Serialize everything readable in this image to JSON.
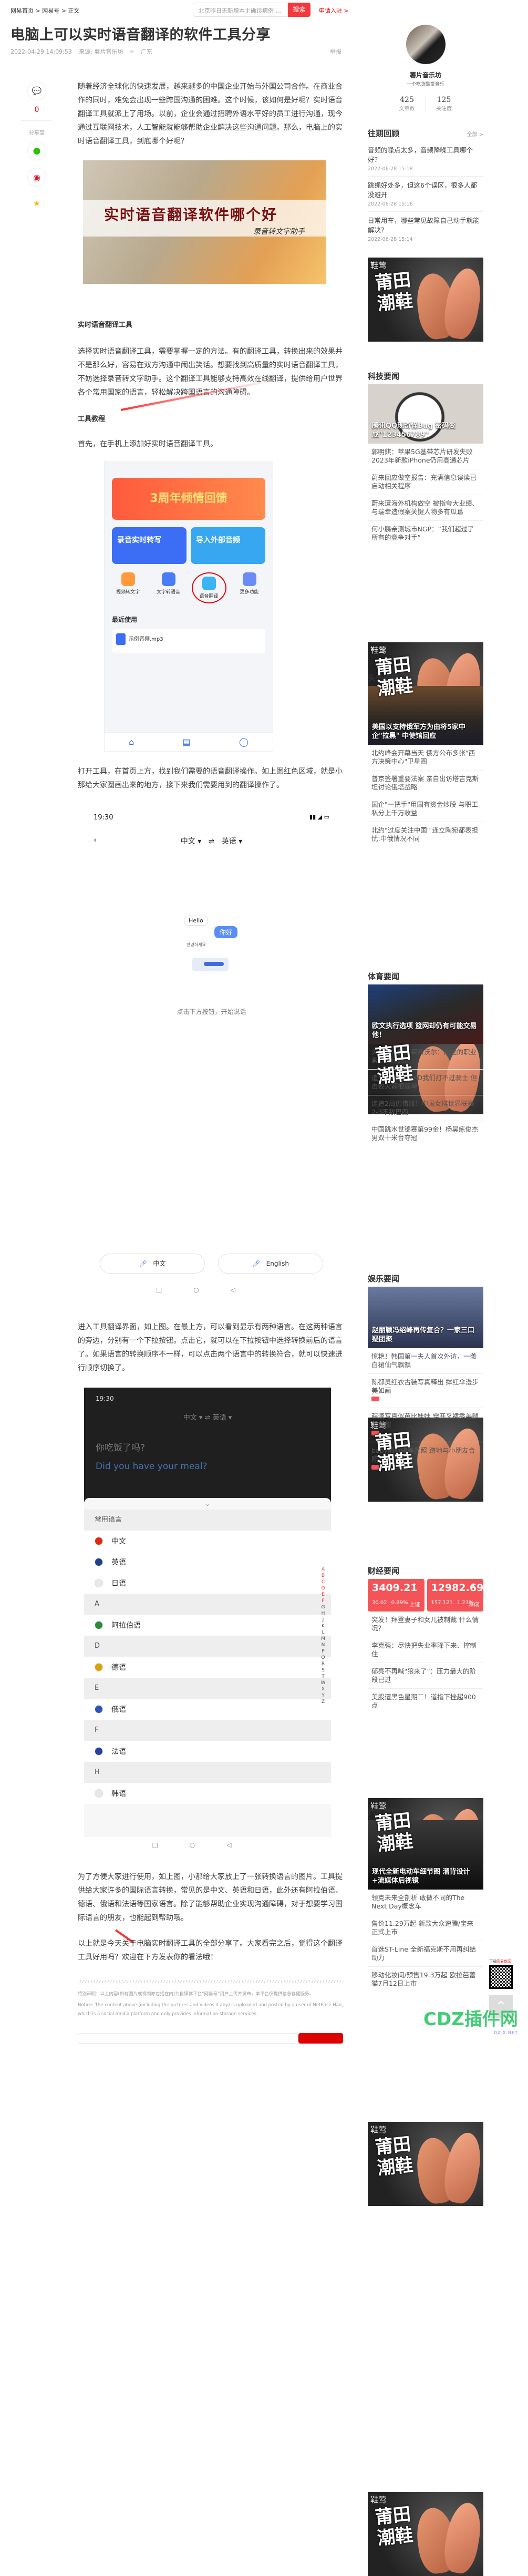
{
  "header": {
    "breadcrumb": "网易首页 > 网易号 > 正文",
    "search_placeholder": "北京昨日无新增本土确诊病例 ...",
    "search_button": "搜索",
    "apply_link": "申请入驻 >"
  },
  "article": {
    "title": "电脑上可以实时语音翻译的软件工具分享",
    "date": "2022-04-29 14:09:53",
    "source": "来源: 薯片音乐坊",
    "location": "广东",
    "report": "举报",
    "paragraphs": [
      "随着经济全球化的快速发展，越来越多的中国企业开始与外国公司合作。在商业合作的同时，难免会出现一些跨国沟通的困难。这个时候，该如何是好呢？实时语音翻译工具就派上了用场。以前，企业会通过招聘外语水平好的员工进行沟通，现今通过互联网技术，人工智能就能够帮助企业解决这些沟通问题。那么，电脑上的实时语音翻译工具，到底哪个好呢？",
      "选择实时语音翻译工具，需要掌握一定的方法。有的翻译工具，转换出来的效果并不是那么好，容易在双方沟通中闹出笑话。想要找到高质量的实时语音翻译工具，不妨选择录音转文字助手。这个翻译工具能够支持高效在线翻译，提供给用户世界各个常用国家的语言，轻松解决跨国语言的沟通障碍。",
      "首先，在手机上添加好实时语音翻译工具。",
      "打开工具，在首页上方，找到我们需要的语音翻译操作。如上图红色区域，就是小那给大家圈画出来的地方，接下来我们需要用到的翻译操作了。",
      "进入工具翻译界面，如上图。在最上方，可以看到显示有两种语言。在这两种语言的旁边，分别有一个下拉按钮。点击它，就可以在下拉按钮中选择转换前后的语言了。如果语言的转换顺序不一样，可以点击两个语言中的转换符合，就可以快速进行顺序切换了。",
      "为了方便大家进行使用，如上图，小那给大家放上了一张转换语言的图片。工具提供给大家许多的国际语言转换，常见的是中文、英语和日语，此外还有阿拉伯语、德语、俄语和法语等国家语言。除了能够帮助企业实现沟通障碍，对于想要学习国际语言的朋友，也能起到帮助哦。",
      "以上就是今天关于电脑实时翻译工具的全部分享了。大家看完之后，觉得这个翻译工具好用吗？欢迎在下方发表你的看法哦！"
    ],
    "headings": [
      "实时语音翻译工具",
      "工具教程"
    ],
    "figure1": {
      "title": "实时语音翻译软件哪个好",
      "subtitle": "录音转文字助手"
    },
    "figure2": {
      "banner": "3周年倾情回馈",
      "card1": "录音实时转写",
      "card2": "导入外部音频",
      "tools": [
        "视频转文字",
        "文字转语音",
        "语音翻译",
        "更多功能"
      ],
      "recent": "最近使用",
      "file": "示例音频.mp3"
    },
    "figure3": {
      "time": "19:30",
      "lang_from": "中文",
      "lang_to": "英语",
      "bubble_en": "Hello",
      "bubble_zh": "你好",
      "bubble_ko": "안녕하세요",
      "hint": "点击下方按钮，开始说话",
      "btn_zh": "中文",
      "btn_en": "English"
    },
    "figure4": {
      "time": "19:30",
      "lang_from": "中文",
      "lang_to": "英语",
      "source_text": "你吃饭了吗?",
      "target_text": "Did you have your meal?",
      "rows": [
        {
          "t": "h",
          "label": "常用语言"
        },
        {
          "t": "l",
          "label": "中文",
          "c": "#de2910"
        },
        {
          "t": "l",
          "label": "英语",
          "c": "#1f3f8f"
        },
        {
          "t": "l",
          "label": "日语",
          "c": "#e8e8e8"
        },
        {
          "t": "h",
          "label": "A"
        },
        {
          "t": "l",
          "label": "阿拉伯语",
          "c": "#2e8b3d"
        },
        {
          "t": "h",
          "label": "D"
        },
        {
          "t": "l",
          "label": "德语",
          "c": "#d8a300"
        },
        {
          "t": "h",
          "label": "E"
        },
        {
          "t": "l",
          "label": "俄语",
          "c": "#2f55b5"
        },
        {
          "t": "h",
          "label": "F"
        },
        {
          "t": "l",
          "label": "法语",
          "c": "#2a3f9f"
        },
        {
          "t": "h",
          "label": "H"
        },
        {
          "t": "l",
          "label": "韩语",
          "c": "#e8e8e8"
        }
      ],
      "index": "ABCDEFGHJKLMNPQRSTWXYZ"
    },
    "comment_count": "0",
    "share_label": "分享至",
    "notice_cn": "特别声明：以上内容(如有图片或视频亦包括在内)为自媒体平台“网易号”用户上传并发布，本平台仅提供信息存储服务。",
    "notice_en": "Notice: The content above (including the pictures and videos if any) is uploaded and posted by a user of NetEase Hao, which is a social media platform and only provides information storage services."
  },
  "author": {
    "name": "薯片音乐坊",
    "tagline": "一个吃货酷爱音乐",
    "articles": "425",
    "articles_label": "文章数",
    "follows": "125",
    "follows_label": "关注度"
  },
  "past": {
    "title": "往期回顾",
    "all": "全部 >",
    "items": [
      {
        "title": "音频的噪点太多，音频降噪工具哪个好？",
        "date": "2022-06-28 15:18"
      },
      {
        "title": "跳绳好处多，但这6个误区，很多人都没避开",
        "date": "2022-06-28 15:16"
      },
      {
        "title": "日常用车，哪些常见故障自己动手就能解决？",
        "date": "2022-06-28 15:14"
      }
    ]
  },
  "ad": {
    "brand": "鞋莺",
    "slogan": "莆田潮鞋"
  },
  "sections": [
    {
      "title": "科技要闻",
      "caption": "腾讯QQ现奇怪Bug 密码变成\"123456789\"",
      "items": [
        "郭明錤：苹果5G基带芯片研发失败 2023年新款iPhone仍用高通芯片",
        "蔚来回应做空报告：充满信息误读已启动相关程序",
        "蔚来遭海外机构做空 被指夸大业绩、与瑞幸造假案关键人物多有瓜葛",
        "何小鹏亲测城市NGP：“我们超过了所有的竞争对手”"
      ]
    },
    {
      "title": "头条要闻",
      "caption": "美国以支持俄军方为由将5家中企\"拉黑\" 中使馆回应",
      "items": [
        "北约峰会开幕当天 俄方公布多张\"西方决策中心\"卫星图",
        "普京签署重要法案 亲自出访塔吉克斯坦讨论俄塔战略",
        "国企\"一把手\"用国有资金炒股 与职工私分上千万收益",
        "北约\"过度关注中国\" 连立陶宛都表担忧:中俄情况不同"
      ]
    },
    {
      "title": "体育要闻",
      "caption": "欧文执行选项 篮网却仍有可能交易他！",
      "items": [
        "火箭官方宣布买断沃尔：向他的职业素养表示感谢",
        "追梦:当年没有KD我们打不过骑士 但击败火箭很简单",
        "连追2局仍惜败！中国女排世界联赛2-3不敌巴西",
        "中国跳水世锦赛第99金！杨昊练俊杰男双十米台夺冠"
      ]
    },
    {
      "title": "娱乐要闻",
      "caption": "赵丽颖冯绍峰再传复合？一家三口疑团聚",
      "items": [
        "惊艳！韩国第一夫人首次外访，一袭白裙仙气飘飘",
        "陈都灵红衣古装写真释出 撑红伞漫步美如画",
        "程潇写真似芭比娃娃 穿开叉裙秀美腿笑容甜",
        "baby晒新疆美景照 蹲地与小朋友合照好亲切"
      ],
      "badges": [
        false,
        true,
        true,
        true
      ]
    },
    {
      "title": "财经要闻",
      "stocks": [
        {
          "value": "3409.21",
          "change": "30.02",
          "pct": "0.89%",
          "name": "上证"
        },
        {
          "value": "12982.69",
          "change": "157.121",
          "pct": "1.23%",
          "name": "深成"
        }
      ],
      "items": [
        "突发！拜登妻子和女儿被制裁 什么情况？",
        "李克强：尽快把失业率降下来、控制住",
        "郁亮不再喊\"狼来了\"：压力最大的阶段已过",
        "美股遭黑色星期二！道指下挫超900点"
      ]
    },
    {
      "title": "汽车要闻",
      "caption": "现代全新电动车细节图 溜背设计+流媒体后视镜",
      "items": [
        "领克未来全剖析 敢做不同的The Next Day概念车",
        "售价11.29万起 新款大众速腾/宝来正式上市",
        "首选ST-Line 全新福克斯不用再纠结动力",
        "移动化妆间/预售19.3万起 欧拉芭蕾猫7月12日上市"
      ]
    }
  ],
  "download": {
    "prefix": "下载",
    "brand": "网易新闻"
  },
  "watermark": {
    "text": "DZ插件网",
    "sub": "DZ-X.NET"
  },
  "colors": {
    "accent": "#f3393d",
    "stock": "#f45457",
    "link_red": "#dd0000"
  }
}
